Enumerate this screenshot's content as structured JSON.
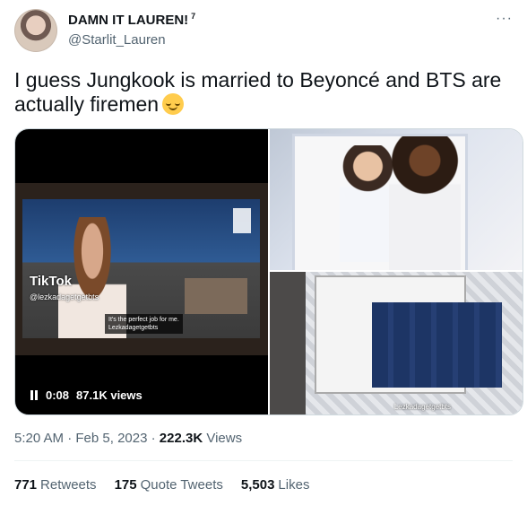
{
  "author": {
    "name": "DAMN IT LAUREN!",
    "superscript": "7",
    "handle": "@Starlit_Lauren"
  },
  "more_icon": "···",
  "tweet": {
    "text": "I guess Jungkook is married to Beyoncé and BTS are actually firemen",
    "emoji": "relieved-face-emoji"
  },
  "video": {
    "tiktok_label": "TikTok",
    "tiktok_user": "@lezkadagetgetbts",
    "caption": "It's the perfect job for me.",
    "caption_user": "Lezkadagetgetbts",
    "time": "0:08",
    "views": "87.1K views"
  },
  "photo2": {
    "watermark": "Lezkadagetgetbts"
  },
  "meta": {
    "time": "5:20 AM",
    "date": "Feb 5, 2023",
    "views_count": "222.3K",
    "views_label": "Views"
  },
  "stats": {
    "retweets_count": "771",
    "retweets_label": "Retweets",
    "quotes_count": "175",
    "quotes_label": "Quote Tweets",
    "likes_count": "5,503",
    "likes_label": "Likes"
  }
}
